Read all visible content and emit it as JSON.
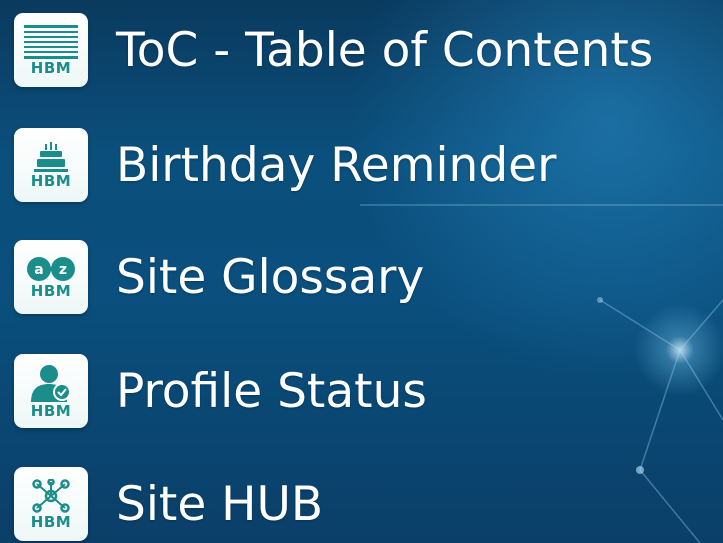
{
  "menu": {
    "items": [
      {
        "label": "ToC - Table of Contents",
        "icon": "table-of-contents-icon",
        "brand": "HBM"
      },
      {
        "label": "Birthday Reminder",
        "icon": "birthday-cake-icon",
        "brand": "HBM"
      },
      {
        "label": "Site Glossary",
        "icon": "glossary-a-z-icon",
        "brand": "HBM"
      },
      {
        "label": "Profile Status",
        "icon": "profile-user-check-icon",
        "brand": "HBM"
      },
      {
        "label": "Site HUB",
        "icon": "hub-network-icon",
        "brand": "HBM"
      }
    ]
  },
  "colors": {
    "background": "#0b4f7c",
    "icon_accent": "#1b8e8b",
    "text": "#ffffff"
  }
}
